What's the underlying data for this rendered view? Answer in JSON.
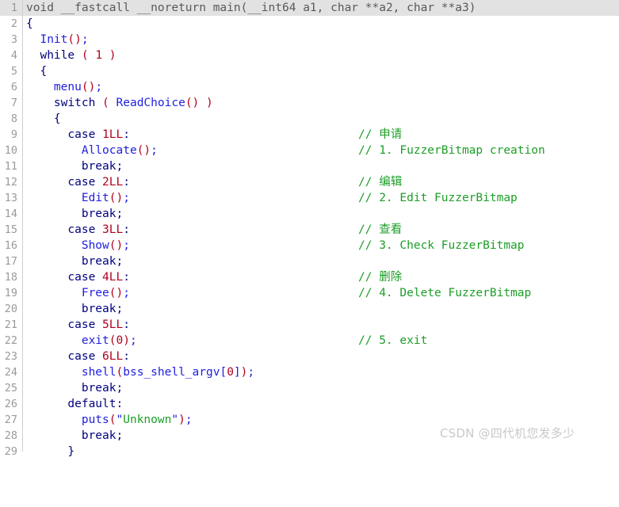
{
  "editor": {
    "language": "c-pseudocode",
    "highlighted_line": 1,
    "colors": {
      "background": "#ffffff",
      "line_highlight": "#e2e2e2",
      "gutter_text": "#9a9a9a",
      "keyword": "#00007f",
      "function": "#2020e0",
      "operator": "#b00020",
      "comment": "#1c9e26",
      "string": "#1c9e26",
      "plain": "#58595b"
    }
  },
  "watermark": {
    "text": "CSDN @四代机您发多少"
  },
  "lines": [
    {
      "no": "1",
      "code": "void __fastcall __noreturn main(__int64 a1, char **a2, char **a3)",
      "comment": ""
    },
    {
      "no": "2",
      "code": "{",
      "comment": ""
    },
    {
      "no": "3",
      "code": "  Init();",
      "comment": ""
    },
    {
      "no": "4",
      "code": "  while ( 1 )",
      "comment": ""
    },
    {
      "no": "5",
      "code": "  {",
      "comment": ""
    },
    {
      "no": "6",
      "code": "    menu();",
      "comment": ""
    },
    {
      "no": "7",
      "code": "    switch ( ReadChoice() )",
      "comment": ""
    },
    {
      "no": "8",
      "code": "    {",
      "comment": ""
    },
    {
      "no": "9",
      "code": "      case 1LL:",
      "comment": "// 申请"
    },
    {
      "no": "10",
      "code": "        Allocate();",
      "comment": "// 1. FuzzerBitmap creation"
    },
    {
      "no": "11",
      "code": "        break;",
      "comment": ""
    },
    {
      "no": "12",
      "code": "      case 2LL:",
      "comment": "// 编辑"
    },
    {
      "no": "13",
      "code": "        Edit();",
      "comment": "// 2. Edit FuzzerBitmap"
    },
    {
      "no": "14",
      "code": "        break;",
      "comment": ""
    },
    {
      "no": "15",
      "code": "      case 3LL:",
      "comment": "// 查看"
    },
    {
      "no": "16",
      "code": "        Show();",
      "comment": "// 3. Check FuzzerBitmap"
    },
    {
      "no": "17",
      "code": "        break;",
      "comment": ""
    },
    {
      "no": "18",
      "code": "      case 4LL:",
      "comment": "// 删除"
    },
    {
      "no": "19",
      "code": "        Free();",
      "comment": "// 4. Delete FuzzerBitmap"
    },
    {
      "no": "20",
      "code": "        break;",
      "comment": ""
    },
    {
      "no": "21",
      "code": "      case 5LL:",
      "comment": ""
    },
    {
      "no": "22",
      "code": "        exit(0);",
      "comment": "// 5. exit"
    },
    {
      "no": "23",
      "code": "      case 6LL:",
      "comment": ""
    },
    {
      "no": "24",
      "code": "        shell(bss_shell_argv[0]);",
      "comment": ""
    },
    {
      "no": "25",
      "code": "        break;",
      "comment": ""
    },
    {
      "no": "26",
      "code": "      default:",
      "comment": ""
    },
    {
      "no": "27",
      "code": "        puts(\"Unknown\");",
      "comment": ""
    },
    {
      "no": "28",
      "code": "        break;",
      "comment": ""
    },
    {
      "no": "29",
      "code": "      }",
      "comment": ""
    }
  ]
}
